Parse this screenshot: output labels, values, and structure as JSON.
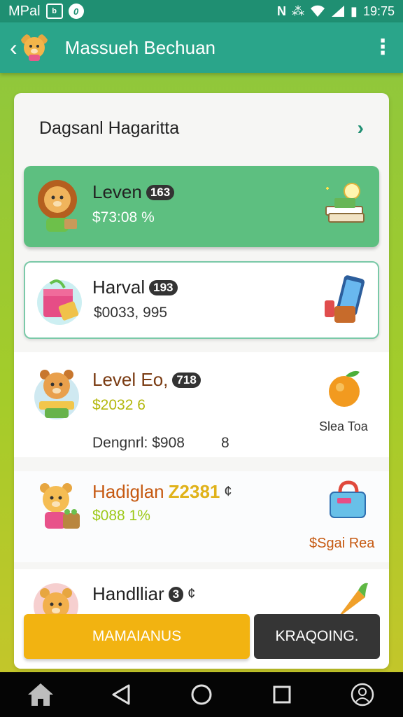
{
  "status_bar": {
    "carrier": "MPal",
    "icon_box": "b",
    "icon_circle": "0",
    "right_icons": "N ⁂ ",
    "battery_glyph": "▮",
    "time": "19:75"
  },
  "app_bar": {
    "back_icon": "chevron-left-icon",
    "title": "Massueh Bechuan"
  },
  "panel": {
    "title": "Dagsanl Hagaritta"
  },
  "items": [
    {
      "name": "Leven",
      "badge": "163",
      "price": "$73:08 %"
    },
    {
      "name": "Harval",
      "badge": "193",
      "price": "$0033, 995"
    },
    {
      "name": "Level Eo,",
      "badge": "718",
      "price": "$2032 6",
      "side_label": "Slea Toa",
      "detail": "Dengnrl: $908",
      "detail_num": "8"
    },
    {
      "name": "Hadiglan",
      "name_accent": "Z2381",
      "name_suffix": "¢",
      "price": "$088 1%",
      "side_label": "$Sgai Rea"
    },
    {
      "name": "Handlliar",
      "badge": "3",
      "badge_suffix": "¢"
    }
  ],
  "buttons": {
    "primary": "MAMAIANUS",
    "secondary": "KRAQOING."
  },
  "nav": [
    "home-icon",
    "back-icon",
    "home-circle-icon",
    "recents-icon",
    "profile-icon"
  ],
  "colors": {
    "primary_green": "#2aa58a",
    "card_green": "#5dbf80",
    "accent_yellow": "#f2b311",
    "price_yellow": "#b4b80e",
    "name_brown": "#7a3b12",
    "name_orange": "#c65a12"
  }
}
